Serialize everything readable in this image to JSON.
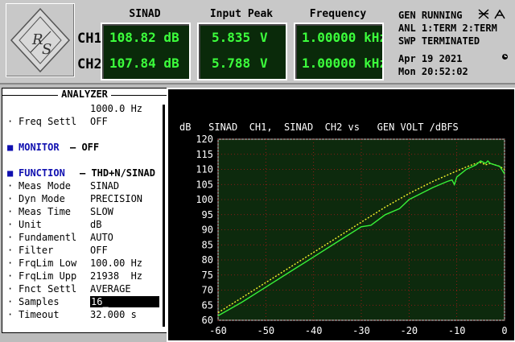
{
  "header": {
    "columns": [
      "SINAD",
      "Input Peak",
      "Frequency"
    ],
    "channels": [
      {
        "label": "CH1",
        "sinad": "108.82 dB",
        "peak_value": "5.835",
        "peak_unit": "V",
        "freq": "1.00000 kHz"
      },
      {
        "label": "CH2",
        "sinad": "107.84 dB",
        "peak_value": "5.788",
        "peak_unit": "V",
        "freq": "1.00000 kHz"
      }
    ],
    "status": {
      "gen": "GEN RUNNING",
      "anl": "ANL 1:TERM 2:TERM",
      "swp": "SWP TERMINATED",
      "date": "Apr 19 2021",
      "time": "Mon 20:52:02"
    },
    "logo_text": "R&S"
  },
  "analyzer": {
    "title": "ANALYZER",
    "rows": [
      {
        "label": "",
        "value": "1000.0 Hz",
        "bullet": ""
      },
      {
        "label": "Freq Settl",
        "value": "OFF",
        "bullet": "·"
      },
      {
        "label": "",
        "value": "",
        "bullet": ""
      },
      {
        "label": "MONITOR",
        "value": "— OFF",
        "bullet": "■",
        "heading": true
      },
      {
        "label": "",
        "value": "",
        "bullet": ""
      },
      {
        "label": "FUNCTION",
        "value": "— THD+N/SINAD",
        "bullet": "■",
        "heading": true
      },
      {
        "label": "Meas Mode",
        "value": "SINAD",
        "bullet": "·"
      },
      {
        "label": "Dyn Mode",
        "value": "PRECISION",
        "bullet": "·"
      },
      {
        "label": "Meas Time",
        "value": "SLOW",
        "bullet": "·"
      },
      {
        "label": "Unit",
        "value": "dB",
        "bullet": "·"
      },
      {
        "label": "Fundamentl",
        "value": "AUTO",
        "bullet": "·"
      },
      {
        "label": "Filter",
        "value": "OFF",
        "bullet": "·"
      },
      {
        "label": "FrqLim Low",
        "value": "100.00 Hz",
        "bullet": "·"
      },
      {
        "label": "FrqLim Upp",
        "value": "21938  Hz",
        "bullet": "·"
      },
      {
        "label": "Fnct Settl",
        "value": "AVERAGE",
        "bullet": "·"
      },
      {
        "label": "Samples",
        "value": "16_",
        "bullet": "·",
        "selected": true
      },
      {
        "label": "Timeout",
        "value": "32.000 s",
        "bullet": "·"
      }
    ]
  },
  "chart_data": {
    "type": "line",
    "title": "dB   SINAD  CH1,  SINAD  CH2 vs   GEN VOLT /dBFS",
    "xlim": [
      -60,
      0
    ],
    "ylim": [
      60,
      120
    ],
    "xticks": [
      -60,
      -50,
      -40,
      -30,
      -20,
      -10,
      0
    ],
    "yticks": [
      60,
      65,
      70,
      75,
      80,
      85,
      90,
      95,
      100,
      105,
      110,
      115,
      120
    ],
    "grid": true,
    "series": [
      {
        "color": "#f4f42a",
        "style": "dotted",
        "x": [
          -60,
          -55,
          -50,
          -45,
          -40,
          -35,
          -30,
          -25,
          -20,
          -15,
          -10,
          -8,
          -6,
          -5,
          -4,
          -3,
          -2,
          -1,
          0
        ],
        "y": [
          62.5,
          67.5,
          72.5,
          77.5,
          82.5,
          87.5,
          92.5,
          97.5,
          102,
          106,
          109.5,
          110.8,
          112,
          112.3,
          111.5,
          112,
          111.5,
          111,
          110
        ]
      },
      {
        "color": "#38f038",
        "style": "solid",
        "x": [
          -60,
          -55,
          -50,
          -45,
          -40,
          -35,
          -30,
          -28,
          -25,
          -22,
          -20,
          -15,
          -12,
          -11,
          -10.5,
          -10,
          -8,
          -6,
          -5,
          -4,
          -3.5,
          -3,
          -2,
          -1,
          0
        ],
        "y": [
          61.5,
          66,
          71,
          76,
          81,
          86,
          91,
          91.5,
          95,
          97,
          100,
          104,
          106,
          106.5,
          105,
          107.5,
          110,
          111.5,
          112.8,
          112,
          112.8,
          112,
          111.5,
          111,
          108.5
        ]
      }
    ]
  }
}
